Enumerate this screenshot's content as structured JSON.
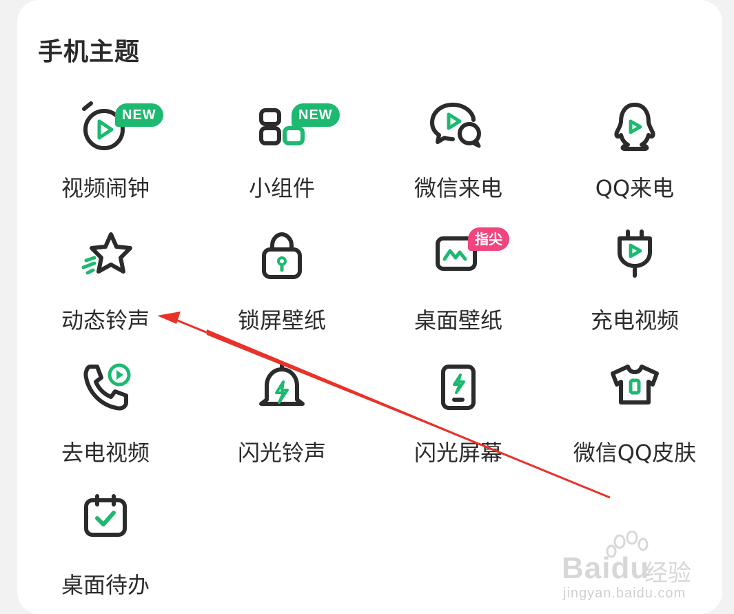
{
  "section": {
    "title": "手机主题"
  },
  "badges": {
    "new": "NEW",
    "tip": "指尖"
  },
  "colors": {
    "accent": "#1db971",
    "dark": "#2b2b2b",
    "tip_badge": "#f0457d",
    "annotation_arrow": "#e8322a"
  },
  "items": [
    {
      "label": "视频闹钟",
      "icon": "video-alarm-icon",
      "badge": "NEW"
    },
    {
      "label": "小组件",
      "icon": "widget-icon",
      "badge": "NEW"
    },
    {
      "label": "微信来电",
      "icon": "wechat-call-icon"
    },
    {
      "label": "QQ来电",
      "icon": "qq-penguin-icon"
    },
    {
      "label": "动态铃声",
      "icon": "dynamic-star-icon"
    },
    {
      "label": "锁屏壁纸",
      "icon": "lock-icon"
    },
    {
      "label": "桌面壁纸",
      "icon": "wallpaper-icon",
      "badge": "指尖"
    },
    {
      "label": "充电视频",
      "icon": "charging-plug-icon"
    },
    {
      "label": "去电视频",
      "icon": "phone-video-icon"
    },
    {
      "label": "闪光铃声",
      "icon": "flash-bell-icon"
    },
    {
      "label": "闪光屏幕",
      "icon": "flash-phone-icon"
    },
    {
      "label": "微信QQ皮肤",
      "icon": "tshirt-icon"
    },
    {
      "label": "桌面待办",
      "icon": "calendar-check-icon"
    }
  ],
  "watermark": {
    "logo": "Baidu",
    "cn": "经验",
    "url": "jingyan.baidu.com"
  }
}
